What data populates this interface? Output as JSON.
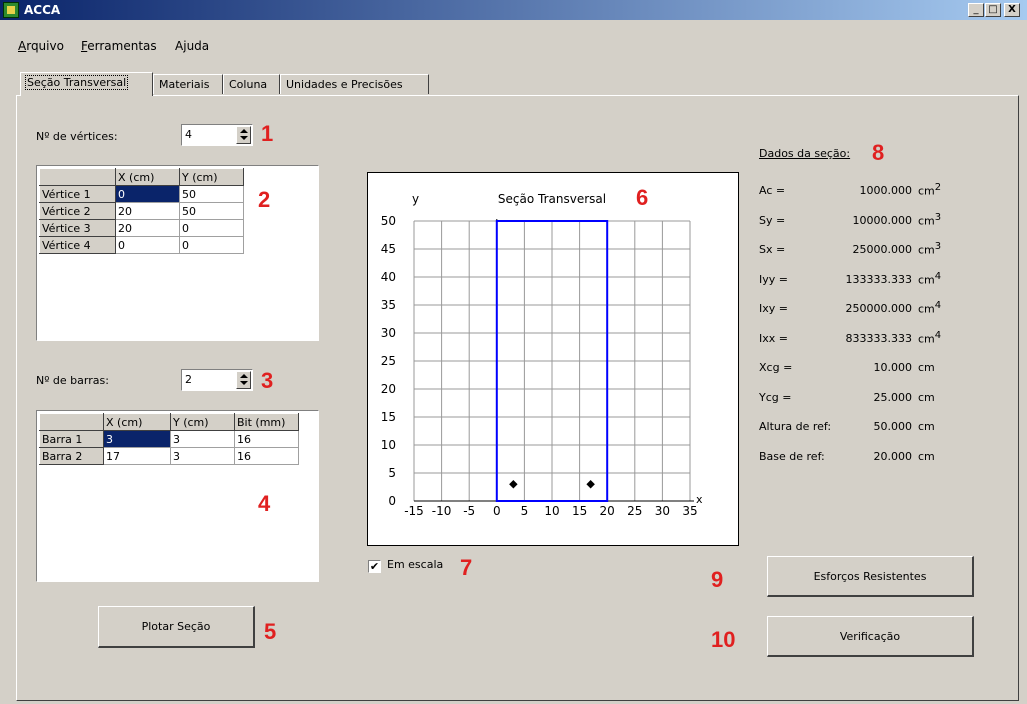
{
  "window": {
    "title": "ACCA",
    "controls": [
      "_",
      "□",
      "X"
    ]
  },
  "menu": [
    {
      "label": "Arquivo",
      "mnemonic": "A",
      "rest": "rquivo"
    },
    {
      "label": "Ferramentas",
      "mnemonic": "F",
      "rest": "erramentas"
    },
    {
      "label": "Ajuda",
      "mnemonic": "j",
      "pre": "A",
      "rest": "uda"
    }
  ],
  "tabs": [
    "Seção Transversal",
    "Materiais",
    "Coluna",
    "Unidades e Precisões"
  ],
  "vertices": {
    "label": "Nº de vértices:",
    "count": "4",
    "headers": [
      "X (cm)",
      "Y (cm)"
    ],
    "rows": [
      {
        "name": "Vértice 1",
        "x": "0",
        "y": "50"
      },
      {
        "name": "Vértice 2",
        "x": "20",
        "y": "50"
      },
      {
        "name": "Vértice 3",
        "x": "20",
        "y": "0"
      },
      {
        "name": "Vértice 4",
        "x": "0",
        "y": "0"
      }
    ]
  },
  "bars": {
    "label": "Nº de barras:",
    "count": "2",
    "headers": [
      "X (cm)",
      "Y (cm)",
      "Bit (mm)"
    ],
    "rows": [
      {
        "name": "Barra 1",
        "x": "3",
        "y": "3",
        "bit": "16"
      },
      {
        "name": "Barra 2",
        "x": "17",
        "y": "3",
        "bit": "16"
      }
    ]
  },
  "plot_button": "Plotar Seção",
  "plot": {
    "title": "Seção Transversal",
    "ylabel": "y",
    "xlabel": "x",
    "scale_checkbox": "Em escala",
    "scale_checked": true
  },
  "chart_data": {
    "type": "scatter",
    "title": "Seção Transversal",
    "xlabel": "x",
    "ylabel": "y",
    "xlim": [
      -15,
      35
    ],
    "ylim": [
      0,
      50
    ],
    "xticks": [
      -15,
      -10,
      -5,
      0,
      5,
      10,
      15,
      20,
      25,
      30,
      35
    ],
    "yticks": [
      0,
      5,
      10,
      15,
      20,
      25,
      30,
      35,
      40,
      45,
      50
    ],
    "grid": true,
    "polygon": [
      [
        0,
        0
      ],
      [
        0,
        50
      ],
      [
        20,
        50
      ],
      [
        20,
        0
      ]
    ],
    "polygon_color": "#0000ff",
    "points": [
      [
        3,
        3
      ],
      [
        17,
        3
      ]
    ]
  },
  "section_data": {
    "heading": "Dados da seção:",
    "rows": [
      {
        "label": "Ac =",
        "value": "1000.000",
        "unit": "cm",
        "exp": "2"
      },
      {
        "label": "Sy =",
        "value": "10000.000",
        "unit": "cm",
        "exp": "3"
      },
      {
        "label": "Sx =",
        "value": "25000.000",
        "unit": "cm",
        "exp": "3"
      },
      {
        "label": "Iyy =",
        "value": "133333.333",
        "unit": "cm",
        "exp": "4"
      },
      {
        "label": "Ixy =",
        "value": "250000.000",
        "unit": "cm",
        "exp": "4"
      },
      {
        "label": "Ixx =",
        "value": "833333.333",
        "unit": "cm",
        "exp": "4"
      },
      {
        "label": "Xcg =",
        "value": "10.000",
        "unit": "cm",
        "exp": ""
      },
      {
        "label": "Ycg =",
        "value": "25.000",
        "unit": "cm",
        "exp": ""
      },
      {
        "label": "Altura de ref:",
        "value": "50.000",
        "unit": "cm",
        "exp": ""
      },
      {
        "label": "Base de ref:",
        "value": "20.000",
        "unit": "cm",
        "exp": ""
      }
    ]
  },
  "buttons": {
    "esforcos": "Esforços Resistentes",
    "verificacao": "Verificação"
  },
  "annotations": [
    "1",
    "2",
    "3",
    "4",
    "5",
    "6",
    "7",
    "8",
    "9",
    "10"
  ],
  "colors": {
    "annotation": "#e02020",
    "selection": "#0a246a",
    "section_outline": "#0000ff"
  }
}
